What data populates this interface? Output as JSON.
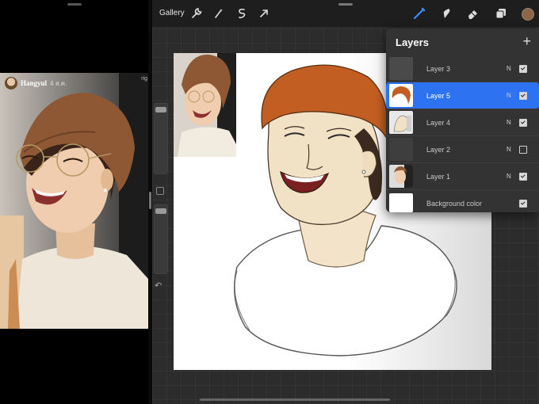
{
  "post": {
    "username": "Hangyul",
    "date": "4 ส.ค.",
    "extra": "rig"
  },
  "toolbar": {
    "gallery_label": "Gallery",
    "icons": [
      "wrench-icon",
      "magic-wand-icon",
      "selection-icon",
      "transform-arrow-icon",
      "brush-icon",
      "smudge-icon",
      "eraser-icon",
      "layers-icon"
    ],
    "active_color": "#8b6647",
    "active_tool_color": "#3d8bff"
  },
  "layers": {
    "title": "Layers",
    "add_label": "+",
    "items": [
      {
        "name": "Layer 3",
        "mode": "N",
        "visible": true,
        "active": false
      },
      {
        "name": "Layer 5",
        "mode": "N",
        "visible": true,
        "active": true
      },
      {
        "name": "Layer 4",
        "mode": "N",
        "visible": true,
        "active": false
      },
      {
        "name": "Layer 2",
        "mode": "N",
        "visible": false,
        "active": false
      },
      {
        "name": "Layer 1",
        "mode": "N",
        "visible": true,
        "active": false
      },
      {
        "name": "Background color",
        "mode": "",
        "visible": true,
        "active": false
      }
    ]
  }
}
